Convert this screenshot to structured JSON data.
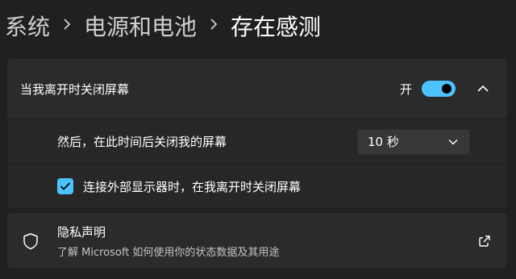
{
  "breadcrumb": [
    "系统",
    "电源和电池",
    "存在感测"
  ],
  "settings": {
    "lock_screen": {
      "label": "当我离开时关闭屏幕",
      "state": "开",
      "enabled": true
    },
    "timeout": {
      "label": "然后，在此时间后关闭我的屏幕",
      "value": "10 秒"
    },
    "external_monitor": {
      "label": "连接外部显示器时，在我离开时关闭屏幕",
      "checked": true
    }
  },
  "privacy": {
    "title": "隐私声明",
    "subtitle": "了解 Microsoft 如何使用你的状态数据及其用途"
  },
  "colors": {
    "accent": "#4cc2ff",
    "background": "#202020",
    "card": "#2b2b2b"
  },
  "icons": [
    "chevron-right-icon",
    "chevron-up-icon",
    "chevron-down-icon",
    "check-icon",
    "shield-icon",
    "external-link-icon"
  ]
}
